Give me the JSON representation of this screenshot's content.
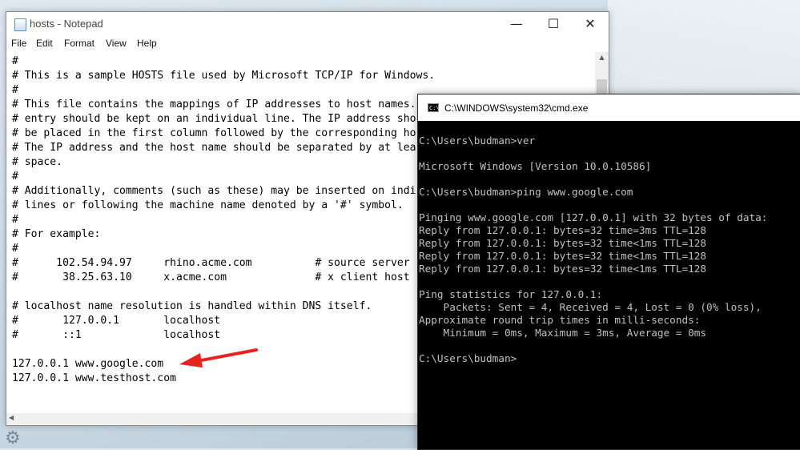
{
  "notepad": {
    "title": "hosts - Notepad",
    "menu": [
      "File",
      "Edit",
      "Format",
      "View",
      "Help"
    ],
    "window_controls": {
      "minimize": "—",
      "maximize": "☐",
      "close": "✕"
    },
    "lines": [
      "#",
      "# This is a sample HOSTS file used by Microsoft TCP/IP for Windows.",
      "#",
      "# This file contains the mappings of IP addresses to host names.",
      "# entry should be kept on an individual line. The IP address sho",
      "# be placed in the first column followed by the corresponding ho",
      "# The IP address and the host name should be separated by at lea",
      "# space.",
      "#",
      "# Additionally, comments (such as these) may be inserted on indi",
      "# lines or following the machine name denoted by a '#' symbol.",
      "#",
      "# For example:",
      "#",
      "#      102.54.94.97     rhino.acme.com          # source server",
      "#       38.25.63.10     x.acme.com              # x client host",
      "",
      "# localhost name resolution is handled within DNS itself.",
      "#       127.0.0.1       localhost",
      "#       ::1             localhost",
      "",
      "127.0.0.1 www.google.com",
      "127.0.0.1 www.testhost.com"
    ]
  },
  "cmd": {
    "title": "C:\\WINDOWS\\system32\\cmd.exe",
    "icon_text": "C:\\",
    "lines": [
      "C:\\Users\\budman>ver",
      "",
      "Microsoft Windows [Version 10.0.10586]",
      "",
      "C:\\Users\\budman>ping www.google.com",
      "",
      "Pinging www.google.com [127.0.0.1] with 32 bytes of data:",
      "Reply from 127.0.0.1: bytes=32 time=3ms TTL=128",
      "Reply from 127.0.0.1: bytes=32 time<1ms TTL=128",
      "Reply from 127.0.0.1: bytes=32 time<1ms TTL=128",
      "Reply from 127.0.0.1: bytes=32 time<1ms TTL=128",
      "",
      "Ping statistics for 127.0.0.1:",
      "    Packets: Sent = 4, Received = 4, Lost = 0 (0% loss),",
      "Approximate round trip times in milli-seconds:",
      "    Minimum = 0ms, Maximum = 3ms, Average = 0ms",
      "",
      "C:\\Users\\budman>"
    ]
  },
  "annotation": {
    "arrow_color": "#e8231e"
  },
  "taskbar": {
    "icon": "gear-icon"
  }
}
